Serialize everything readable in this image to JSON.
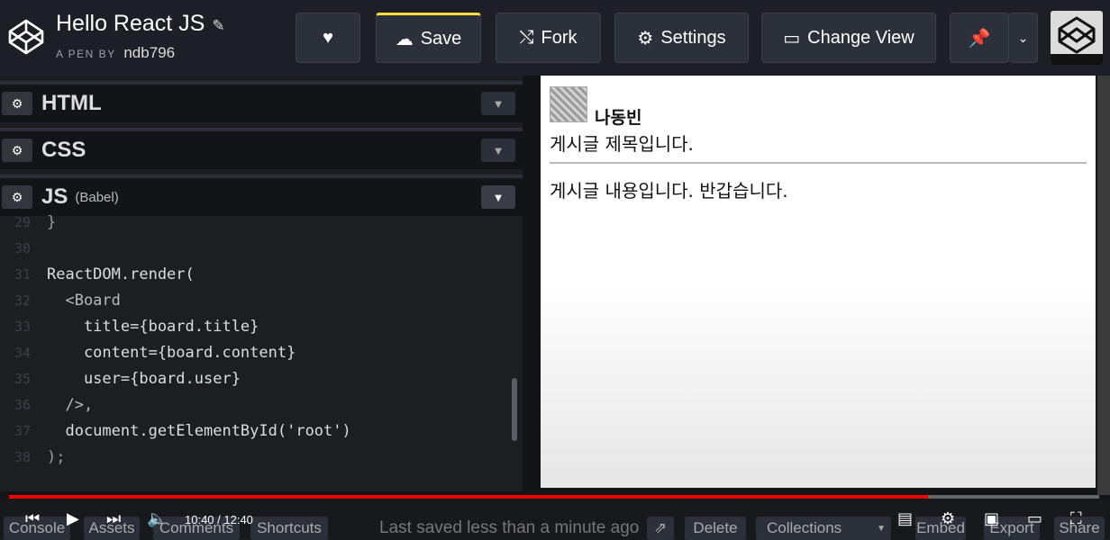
{
  "header": {
    "title": "Hello React JS",
    "byline_prefix": "A PEN BY",
    "author": "ndb796",
    "buttons": {
      "save": "Save",
      "fork": "Fork",
      "settings": "Settings",
      "change_view": "Change View"
    }
  },
  "panels": [
    {
      "name": "HTML",
      "sub": ""
    },
    {
      "name": "CSS",
      "sub": ""
    },
    {
      "name": "JS",
      "sub": "(Babel)"
    }
  ],
  "code": {
    "lines": [
      {
        "num": "29",
        "text": "}"
      },
      {
        "num": "30",
        "text": ""
      },
      {
        "num": "31",
        "text": "ReactDOM.render("
      },
      {
        "num": "32",
        "text": "  <Board"
      },
      {
        "num": "33",
        "text": "    title={board.title}"
      },
      {
        "num": "34",
        "text": "    content={board.content}"
      },
      {
        "num": "35",
        "text": "    user={board.user}"
      },
      {
        "num": "36",
        "text": "  />,"
      },
      {
        "num": "37",
        "text": "  document.getElementById('root')"
      },
      {
        "num": "38",
        "text": ");"
      }
    ]
  },
  "preview": {
    "user_name": "나동빈",
    "post_title": "게시글 제목입니다.",
    "post_content": "게시글 내용입니다. 반갑습니다."
  },
  "footer": {
    "console": "Console",
    "assets": "Assets",
    "comments": "Comments",
    "shortcuts": "Shortcuts",
    "last_saved": "Last saved less than a minute ago",
    "delete": "Delete",
    "collections": "Collections",
    "embed": "Embed",
    "export": "Export",
    "share": "Share"
  },
  "video": {
    "time": "10:40 / 12:40",
    "progress": 0.843
  },
  "colors": {
    "accent_yellow": "#ffdd40",
    "progress_red": "#ee0000"
  }
}
